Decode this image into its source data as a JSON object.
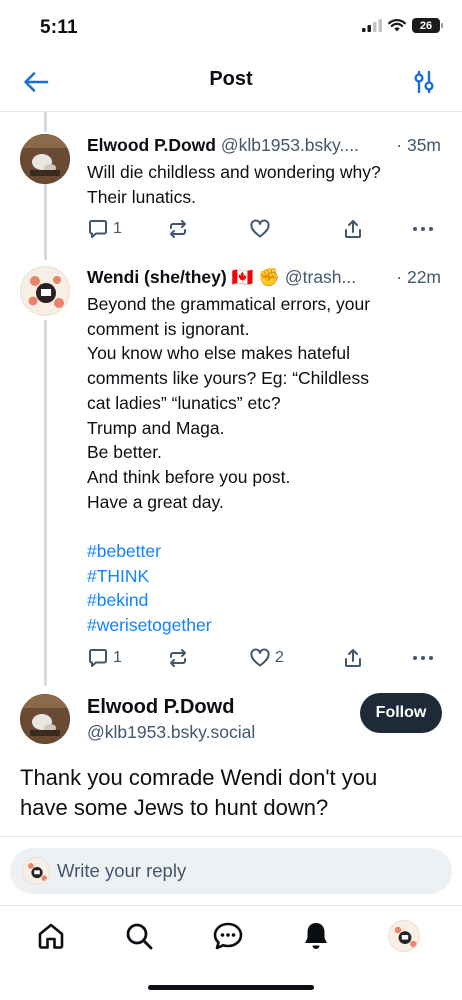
{
  "status_bar": {
    "time": "5:11",
    "battery": "26"
  },
  "header": {
    "title": "Post"
  },
  "posts": [
    {
      "display_name": "Elwood P.Dowd",
      "handle": "@klb1953.bsky....",
      "time": "· 35m",
      "lines": [
        "Will die childless and wondering why?",
        "Their lunatics."
      ],
      "counts": {
        "replies": "1",
        "reposts": "",
        "likes": ""
      }
    },
    {
      "display_name": "Wendi (she/they) 🇨🇦 ✊",
      "handle": "@trash...",
      "time": "· 22m",
      "lines": [
        "Beyond the grammatical errors, your",
        "comment is ignorant.",
        "You know who else makes hateful",
        "comments like yours? Eg: “Childless",
        "cat ladies” “lunatics” etc?",
        "Trump and Maga.",
        "Be better.",
        "And think before you post.",
        "Have a great day."
      ],
      "hashtags": [
        "#bebetter",
        "#THINK",
        "#bekind",
        "#werisetogether"
      ],
      "counts": {
        "replies": "1",
        "reposts": "",
        "likes": "2"
      }
    }
  ],
  "focused_post": {
    "display_name": "Elwood P.Dowd",
    "handle": "@klb1953.bsky.social",
    "follow_label": "Follow",
    "lines": [
      "Thank you comrade Wendi don't you",
      "have some Jews to hunt down?"
    ]
  },
  "reply": {
    "placeholder": "Write your reply"
  },
  "tabs": [
    "home-icon",
    "search-icon",
    "chat-icon",
    "bell-icon",
    "profile-avatar"
  ],
  "colors": {
    "accent": "#1083fe",
    "muted": "#42576c",
    "follow_bg": "#1e2a38",
    "reply_bg": "#eef1f4"
  }
}
